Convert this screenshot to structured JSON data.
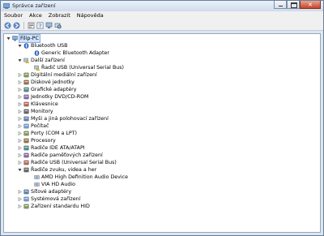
{
  "window": {
    "title": "Správce zařízení"
  },
  "menu": [
    "Soubor",
    "Akce",
    "Zobrazit",
    "Nápověda"
  ],
  "toolbar": [
    "back-icon",
    "forward-icon",
    "properties-icon",
    "help-icon",
    "update-icon",
    "scan-icon"
  ],
  "tree": {
    "root": "Filip-PC",
    "categories": [
      {
        "label": "Bluetooth USB",
        "expanded": true,
        "icon": "bluetooth-icon",
        "children": [
          "Generic Bluetooth Adapter"
        ]
      },
      {
        "label": "Další zařízení",
        "expanded": true,
        "icon": "other-devices-icon",
        "children": [
          "Řadič USB (Universal Serial Bus)"
        ]
      },
      {
        "label": "Digitální mediální zařízení",
        "expanded": false,
        "icon": "media-icon"
      },
      {
        "label": "Diskové jednotky",
        "expanded": false,
        "icon": "disk-icon"
      },
      {
        "label": "Grafické adaptéry",
        "expanded": false,
        "icon": "display-adapter-icon"
      },
      {
        "label": "Jednotky DVD/CD-ROM",
        "expanded": false,
        "icon": "dvd-icon"
      },
      {
        "label": "Klávesnice",
        "expanded": false,
        "icon": "keyboard-icon"
      },
      {
        "label": "Monitory",
        "expanded": false,
        "icon": "monitor-icon"
      },
      {
        "label": "Myši a jiná polohovací zařízení",
        "expanded": false,
        "icon": "mouse-icon"
      },
      {
        "label": "Počítač",
        "expanded": false,
        "icon": "computer-icon"
      },
      {
        "label": "Porty (COM a LPT)",
        "expanded": false,
        "icon": "port-icon"
      },
      {
        "label": "Procesory",
        "expanded": false,
        "icon": "processor-icon"
      },
      {
        "label": "Radiče IDE ATA/ATAPI",
        "expanded": false,
        "icon": "ide-icon"
      },
      {
        "label": "Radiče paměťových zařízení",
        "expanded": false,
        "icon": "storage-icon"
      },
      {
        "label": "Radiče USB (Universal Serial Bus)",
        "expanded": false,
        "icon": "usb-icon"
      },
      {
        "label": "Řadiče zvuku, videa a her",
        "expanded": true,
        "icon": "sound-icon",
        "children": [
          "AMD High Definition Audio Device",
          "VIA HD Audio"
        ]
      },
      {
        "label": "Síťové adaptéry",
        "expanded": false,
        "icon": "network-icon"
      },
      {
        "label": "Systémová zařízení",
        "expanded": false,
        "icon": "system-icon"
      },
      {
        "label": "Zařízení standardu HID",
        "expanded": false,
        "icon": "hid-icon"
      }
    ]
  },
  "colors": {
    "titlebar": "#dbe6f3",
    "selection": "#cfe3fb",
    "close": "#c8432a"
  }
}
